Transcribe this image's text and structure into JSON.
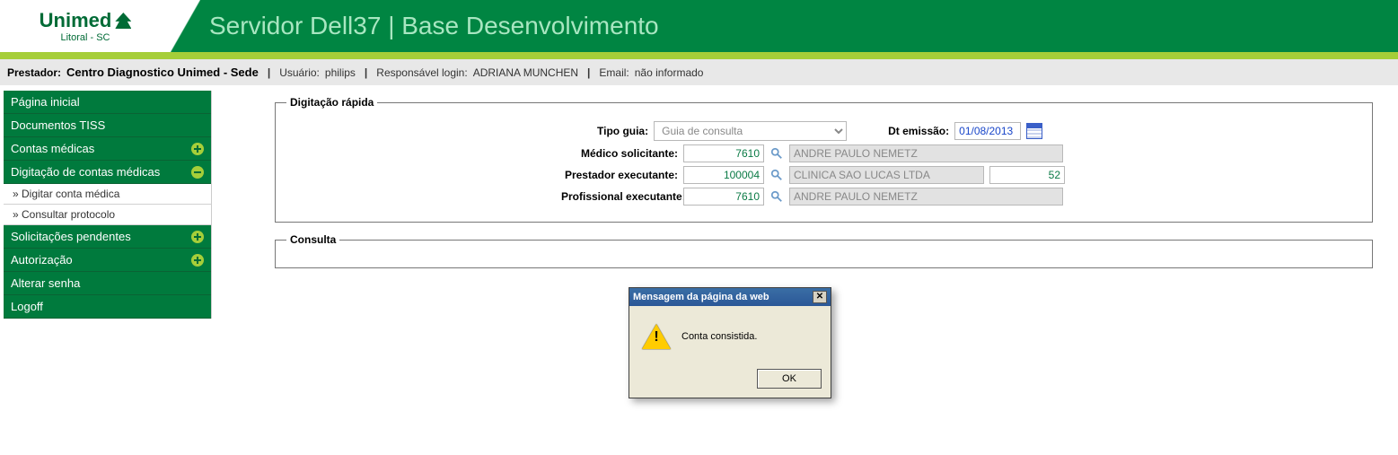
{
  "banner": {
    "logo_text": "Unimed",
    "logo_sub": "Litoral - SC",
    "title": "Servidor Dell37 | Base Desenvolvimento"
  },
  "info": {
    "prestador_label": "Prestador:",
    "prestador_value": "Centro Diagnostico Unimed - Sede",
    "usuario_label": "Usuário:",
    "usuario_value": "philips",
    "resp_label": "Responsável login:",
    "resp_value": "ADRIANA MUNCHEN",
    "email_label": "Email:",
    "email_value": "não informado"
  },
  "sidebar": {
    "items": [
      {
        "label": "Página inicial",
        "expand": null
      },
      {
        "label": "Documentos TISS",
        "expand": null
      },
      {
        "label": "Contas médicas",
        "expand": "plus"
      },
      {
        "label": "Digitação de contas médicas",
        "expand": "minus"
      },
      {
        "label": "Solicitações pendentes",
        "expand": "plus"
      },
      {
        "label": "Autorização",
        "expand": "plus"
      },
      {
        "label": "Alterar senha",
        "expand": null
      },
      {
        "label": "Logoff",
        "expand": null
      }
    ],
    "subs": [
      {
        "label": "» Digitar conta médica"
      },
      {
        "label": "» Consultar protocolo"
      }
    ]
  },
  "fieldset1": {
    "legend": "Digitação rápida",
    "tipo_label": "Tipo guia:",
    "tipo_value": "Guia de consulta",
    "dt_label": "Dt emissão:",
    "dt_value": "01/08/2013",
    "medico_label": "Médico solicitante:",
    "medico_code": "7610",
    "medico_desc": "ANDRE PAULO NEMETZ",
    "prest_label": "Prestador executante:",
    "prest_code": "100004",
    "prest_desc": "CLINICA SAO LUCAS LTDA",
    "prest_extra": "52",
    "prof_label": "Profissional executante:",
    "prof_code": "7610",
    "prof_desc": "ANDRE PAULO NEMETZ"
  },
  "fieldset2": {
    "legend": "Consulta"
  },
  "dialog": {
    "title": "Mensagem da página da web",
    "message": "Conta consistida.",
    "ok": "OK"
  }
}
